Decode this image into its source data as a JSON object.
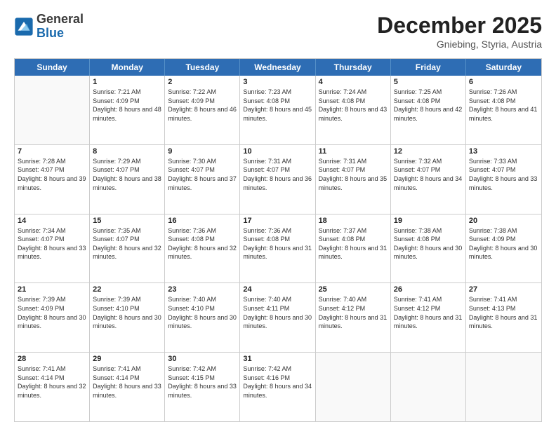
{
  "header": {
    "logo_line1": "General",
    "logo_line2": "Blue",
    "month": "December 2025",
    "location": "Gniebing, Styria, Austria"
  },
  "days_of_week": [
    "Sunday",
    "Monday",
    "Tuesday",
    "Wednesday",
    "Thursday",
    "Friday",
    "Saturday"
  ],
  "weeks": [
    [
      {
        "day": "",
        "empty": true
      },
      {
        "day": "1",
        "sunrise": "7:21 AM",
        "sunset": "4:09 PM",
        "daylight": "8 hours and 48 minutes."
      },
      {
        "day": "2",
        "sunrise": "7:22 AM",
        "sunset": "4:09 PM",
        "daylight": "8 hours and 46 minutes."
      },
      {
        "day": "3",
        "sunrise": "7:23 AM",
        "sunset": "4:08 PM",
        "daylight": "8 hours and 45 minutes."
      },
      {
        "day": "4",
        "sunrise": "7:24 AM",
        "sunset": "4:08 PM",
        "daylight": "8 hours and 43 minutes."
      },
      {
        "day": "5",
        "sunrise": "7:25 AM",
        "sunset": "4:08 PM",
        "daylight": "8 hours and 42 minutes."
      },
      {
        "day": "6",
        "sunrise": "7:26 AM",
        "sunset": "4:08 PM",
        "daylight": "8 hours and 41 minutes."
      }
    ],
    [
      {
        "day": "7",
        "sunrise": "7:28 AM",
        "sunset": "4:07 PM",
        "daylight": "8 hours and 39 minutes."
      },
      {
        "day": "8",
        "sunrise": "7:29 AM",
        "sunset": "4:07 PM",
        "daylight": "8 hours and 38 minutes."
      },
      {
        "day": "9",
        "sunrise": "7:30 AM",
        "sunset": "4:07 PM",
        "daylight": "8 hours and 37 minutes."
      },
      {
        "day": "10",
        "sunrise": "7:31 AM",
        "sunset": "4:07 PM",
        "daylight": "8 hours and 36 minutes."
      },
      {
        "day": "11",
        "sunrise": "7:31 AM",
        "sunset": "4:07 PM",
        "daylight": "8 hours and 35 minutes."
      },
      {
        "day": "12",
        "sunrise": "7:32 AM",
        "sunset": "4:07 PM",
        "daylight": "8 hours and 34 minutes."
      },
      {
        "day": "13",
        "sunrise": "7:33 AM",
        "sunset": "4:07 PM",
        "daylight": "8 hours and 33 minutes."
      }
    ],
    [
      {
        "day": "14",
        "sunrise": "7:34 AM",
        "sunset": "4:07 PM",
        "daylight": "8 hours and 33 minutes."
      },
      {
        "day": "15",
        "sunrise": "7:35 AM",
        "sunset": "4:07 PM",
        "daylight": "8 hours and 32 minutes."
      },
      {
        "day": "16",
        "sunrise": "7:36 AM",
        "sunset": "4:08 PM",
        "daylight": "8 hours and 32 minutes."
      },
      {
        "day": "17",
        "sunrise": "7:36 AM",
        "sunset": "4:08 PM",
        "daylight": "8 hours and 31 minutes."
      },
      {
        "day": "18",
        "sunrise": "7:37 AM",
        "sunset": "4:08 PM",
        "daylight": "8 hours and 31 minutes."
      },
      {
        "day": "19",
        "sunrise": "7:38 AM",
        "sunset": "4:08 PM",
        "daylight": "8 hours and 30 minutes."
      },
      {
        "day": "20",
        "sunrise": "7:38 AM",
        "sunset": "4:09 PM",
        "daylight": "8 hours and 30 minutes."
      }
    ],
    [
      {
        "day": "21",
        "sunrise": "7:39 AM",
        "sunset": "4:09 PM",
        "daylight": "8 hours and 30 minutes."
      },
      {
        "day": "22",
        "sunrise": "7:39 AM",
        "sunset": "4:10 PM",
        "daylight": "8 hours and 30 minutes."
      },
      {
        "day": "23",
        "sunrise": "7:40 AM",
        "sunset": "4:10 PM",
        "daylight": "8 hours and 30 minutes."
      },
      {
        "day": "24",
        "sunrise": "7:40 AM",
        "sunset": "4:11 PM",
        "daylight": "8 hours and 30 minutes."
      },
      {
        "day": "25",
        "sunrise": "7:40 AM",
        "sunset": "4:12 PM",
        "daylight": "8 hours and 31 minutes."
      },
      {
        "day": "26",
        "sunrise": "7:41 AM",
        "sunset": "4:12 PM",
        "daylight": "8 hours and 31 minutes."
      },
      {
        "day": "27",
        "sunrise": "7:41 AM",
        "sunset": "4:13 PM",
        "daylight": "8 hours and 31 minutes."
      }
    ],
    [
      {
        "day": "28",
        "sunrise": "7:41 AM",
        "sunset": "4:14 PM",
        "daylight": "8 hours and 32 minutes."
      },
      {
        "day": "29",
        "sunrise": "7:41 AM",
        "sunset": "4:14 PM",
        "daylight": "8 hours and 33 minutes."
      },
      {
        "day": "30",
        "sunrise": "7:42 AM",
        "sunset": "4:15 PM",
        "daylight": "8 hours and 33 minutes."
      },
      {
        "day": "31",
        "sunrise": "7:42 AM",
        "sunset": "4:16 PM",
        "daylight": "8 hours and 34 minutes."
      },
      {
        "day": "",
        "empty": true
      },
      {
        "day": "",
        "empty": true
      },
      {
        "day": "",
        "empty": true
      }
    ]
  ]
}
